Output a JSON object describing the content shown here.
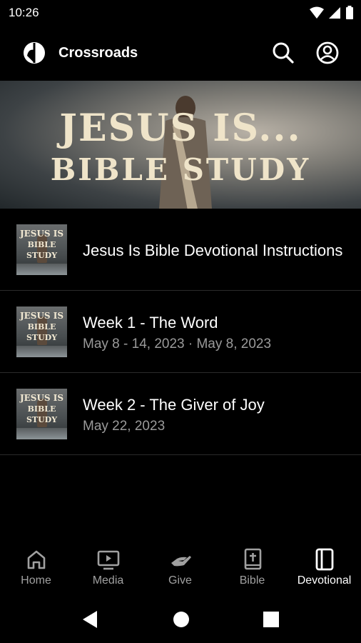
{
  "status": {
    "time": "10:26"
  },
  "app": {
    "title": "Crossroads"
  },
  "hero": {
    "line1": "JESUS IS...",
    "line2": "BIBLE STUDY"
  },
  "thumb": {
    "line1": "JESUS IS",
    "line2": "BIBLE",
    "line3": "STUDY"
  },
  "items": [
    {
      "title": "Jesus Is Bible Devotional Instructions",
      "subtitle": ""
    },
    {
      "title": "Week 1 - The Word",
      "subtitle": "May 8 - 14, 2023 · May 8, 2023"
    },
    {
      "title": "Week 2 - The Giver of Joy",
      "subtitle": "May 22, 2023"
    }
  ],
  "nav": [
    {
      "label": "Home",
      "icon": "home-icon"
    },
    {
      "label": "Media",
      "icon": "media-icon"
    },
    {
      "label": "Give",
      "icon": "give-icon"
    },
    {
      "label": "Bible",
      "icon": "bible-icon"
    },
    {
      "label": "Devotional",
      "icon": "devotional-icon",
      "active": true
    }
  ],
  "colors": {
    "background": "#000000",
    "inactive": "#a0a0a0",
    "subtitle": "#9a9a9a",
    "hero_text": "#efe4c9"
  }
}
